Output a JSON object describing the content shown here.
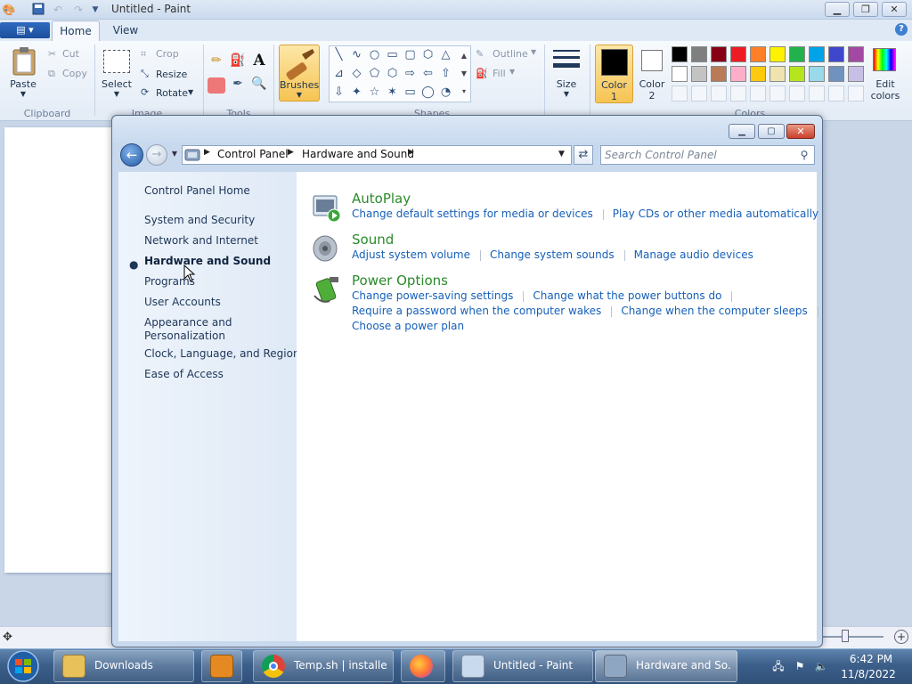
{
  "paint": {
    "title": "Untitled - Paint",
    "tabs": [
      {
        "label": "Home"
      },
      {
        "label": "View"
      }
    ],
    "clipboard": {
      "paste": "Paste",
      "cut": "Cut",
      "copy": "Copy",
      "group": "Clipboard"
    },
    "image": {
      "select": "Select",
      "crop": "Crop",
      "resize": "Resize",
      "rotate": "Rotate",
      "group": "Image"
    },
    "tools": {
      "group": "Tools"
    },
    "brushes": {
      "label": "Brushes"
    },
    "shapes": {
      "outline": "Outline",
      "fill": "Fill",
      "group": "Shapes"
    },
    "size": {
      "label": "Size"
    },
    "color1": {
      "label": "Color",
      "num": "1"
    },
    "color2": {
      "label": "Color",
      "num": "2"
    },
    "colors_group": "Colors",
    "edit_colors": {
      "line1": "Edit",
      "line2": "colors"
    },
    "palette_row1": [
      "#000000",
      "#7f7f7f",
      "#880015",
      "#ed1c24",
      "#ff7f27",
      "#fff200",
      "#22b14c",
      "#00a2e8",
      "#3f48cc",
      "#a349a4"
    ],
    "palette_row2": [
      "#ffffff",
      "#c3c3c3",
      "#b97a57",
      "#ffaec9",
      "#ffc90e",
      "#efe4b0",
      "#b5e61d",
      "#99d9ea",
      "#7092be",
      "#c8bfe7"
    ]
  },
  "control_panel": {
    "breadcrumb": [
      "Control Panel",
      "Hardware and Sound"
    ],
    "search_placeholder": "Search Control Panel",
    "nav": {
      "home": "Control Panel Home",
      "items": [
        {
          "label": "System and Security",
          "active": false
        },
        {
          "label": "Network and Internet",
          "active": false
        },
        {
          "label": "Hardware and Sound",
          "active": true
        },
        {
          "label": "Programs",
          "active": false
        },
        {
          "label": "User Accounts",
          "active": false
        },
        {
          "label": "Appearance and Personalization",
          "active": false
        },
        {
          "label": "Clock, Language, and Region",
          "active": false
        },
        {
          "label": "Ease of Access",
          "active": false
        }
      ]
    },
    "categories": [
      {
        "title": "AutoPlay",
        "icon": "autoplay-icon",
        "links": [
          "Change default settings for media or devices",
          "Play CDs or other media automatically"
        ]
      },
      {
        "title": "Sound",
        "icon": "speaker-icon",
        "links": [
          "Adjust system volume",
          "Change system sounds",
          "Manage audio devices"
        ]
      },
      {
        "title": "Power Options",
        "icon": "battery-icon",
        "links": [
          "Change power-saving settings",
          "Change what the power buttons do",
          "Require a password when the computer wakes",
          "Change when the computer sleeps",
          "Choose a power plan"
        ]
      }
    ]
  },
  "taskbar": {
    "items": [
      {
        "label": "Downloads",
        "icon": "folder-icon"
      },
      {
        "label": "",
        "icon": "media-player-icon"
      },
      {
        "label": "Temp.sh | installe...",
        "icon": "chrome-icon"
      },
      {
        "label": "",
        "icon": "firefox-icon"
      },
      {
        "label": "Untitled - Paint",
        "icon": "paint-icon"
      },
      {
        "label": "Hardware and So...",
        "icon": "control-panel-icon"
      }
    ],
    "time": "6:42 PM",
    "date": "11/8/2022"
  }
}
